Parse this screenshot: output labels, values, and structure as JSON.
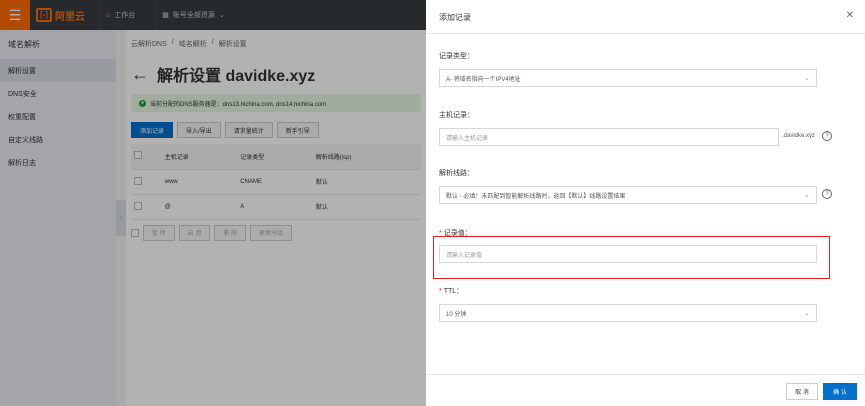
{
  "topbar": {
    "menu_icon": "hamburger-icon",
    "logo_mark": "[-]",
    "logo_text": "阿里云",
    "workbench_label": "工作台",
    "account_label": "账号全部资源"
  },
  "sidebar": {
    "title": "域名解析",
    "items": [
      {
        "label": "解析设置",
        "active": true
      },
      {
        "label": "DNS安全"
      },
      {
        "label": "权重配置"
      },
      {
        "label": "自定义线路"
      },
      {
        "label": "解析日志"
      }
    ]
  },
  "main": {
    "breadcrumb": [
      "云解析DNS",
      "/",
      "域名解析",
      "/",
      "解析设置"
    ],
    "title": "解析设置 davidke.xyz",
    "notice": "当前分配的DNS服务器是：dns13.hichina.com, dns14.hichina.com",
    "toolbar": [
      "添加记录",
      "导入/导出",
      "请求量统计",
      "新手引导"
    ],
    "table": {
      "headers": [
        "主机记录",
        "记录类型",
        "解析线路(isp)"
      ],
      "rows": [
        [
          "www",
          "CNAME",
          "默认"
        ],
        [
          "@",
          "A",
          "默认"
        ]
      ]
    },
    "bulk_actions": [
      "暂 停",
      "启 用",
      "删 除",
      "更换分组"
    ]
  },
  "panel": {
    "title": "添加记录",
    "record_type_label": "记录类型：",
    "record_type_value": "A- 将域名指向一个IPV4地址",
    "host_label": "主机记录：",
    "host_placeholder": "请输入主机记录",
    "host_suffix": ".davidke.xyz",
    "line_label": "解析线路：",
    "line_value": "默认 - 必填！未匹配到智能解析线路时，返回【默认】线路设置结果",
    "value_label": "记录值：",
    "value_placeholder": "请输入记录值",
    "ttl_label": "TTL：",
    "ttl_value": "10 分钟",
    "cancel_label": "取 消",
    "ok_label": "确 认"
  },
  "colors": {
    "accent": "#ff6a00",
    "primary": "#0070cc",
    "highlight": "#e02020"
  }
}
